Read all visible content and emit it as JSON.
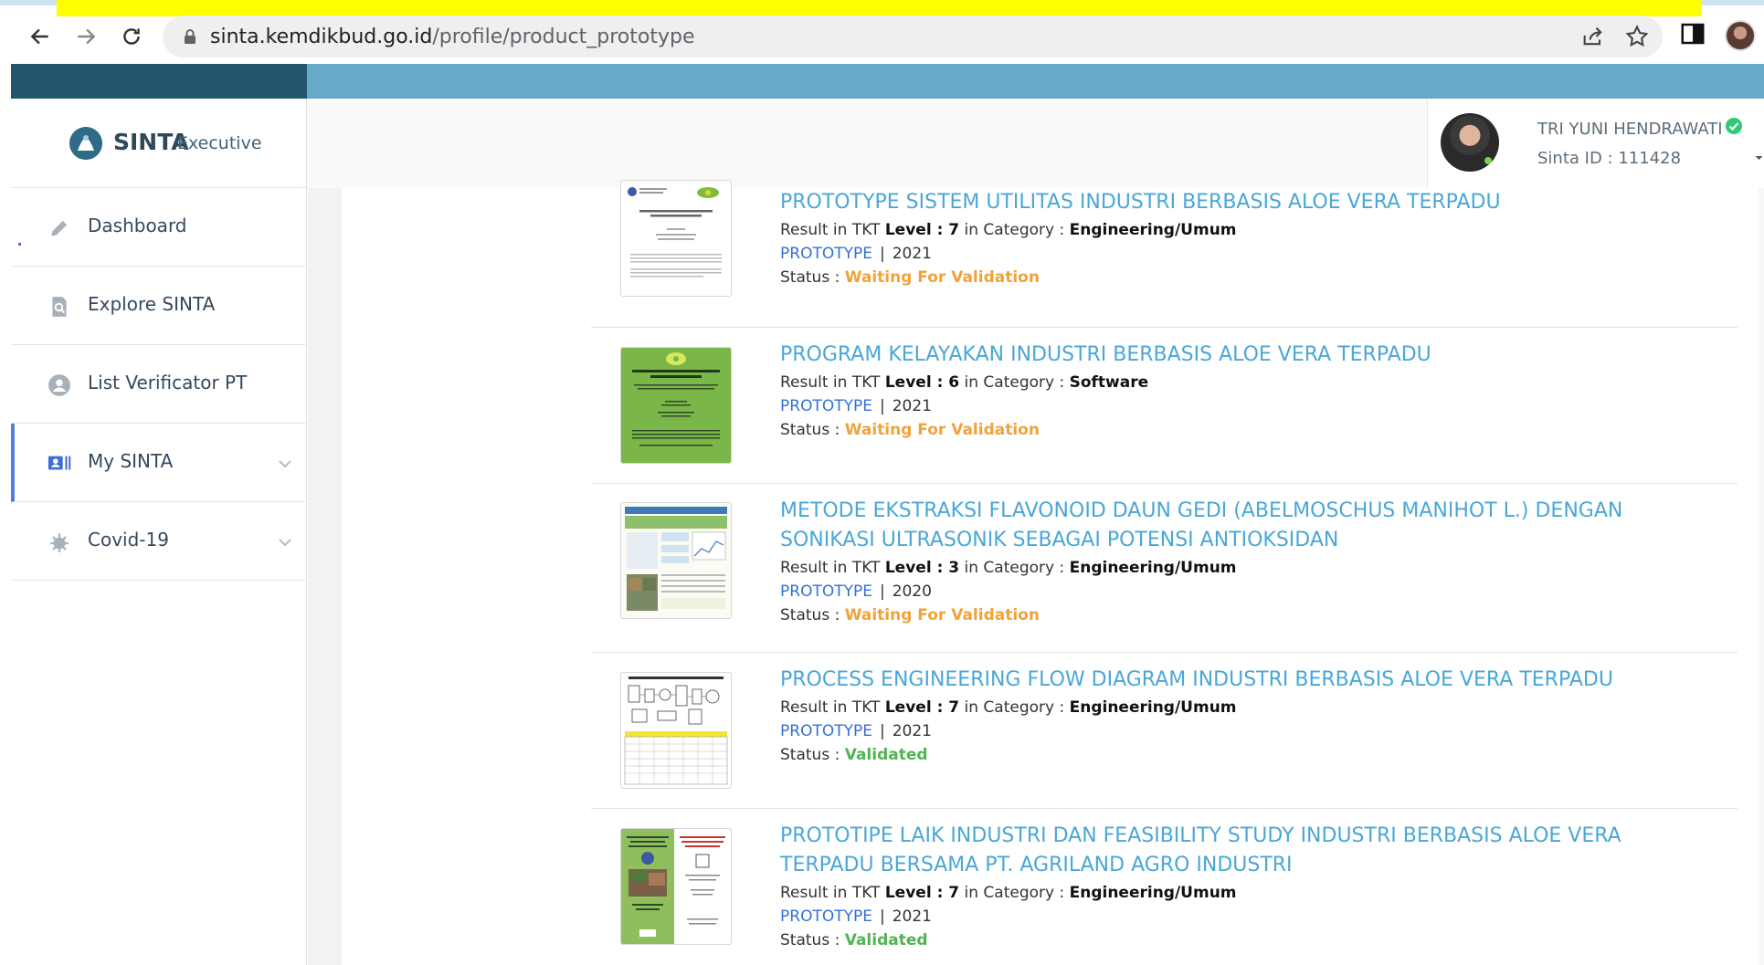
{
  "browser": {
    "url_domain": "sinta.kemdikbud.go.id",
    "url_path": "/profile/product_prototype"
  },
  "brand": {
    "name": "SINTA",
    "subtitle": "Executive"
  },
  "sidebar": {
    "items": [
      {
        "label": "Dashboard",
        "icon": "pencil-icon"
      },
      {
        "label": "Explore SINTA",
        "icon": "search-doc-icon"
      },
      {
        "label": "List Verificator PT",
        "icon": "user-circle-icon"
      },
      {
        "label": "My SINTA",
        "icon": "id-card-icon",
        "active": true
      },
      {
        "label": "Covid-19",
        "icon": "virus-icon"
      }
    ]
  },
  "user": {
    "name": "TRI YUNI HENDRAWATI",
    "sinta_id": "Sinta ID : 111428"
  },
  "items": [
    {
      "title": "PROTOTYPE SISTEM UTILITAS INDUSTRI BERBASIS ALOE VERA TERPADU",
      "result_prefix": "Result in TKT",
      "level_label": "Level : 7",
      "category_prefix": "in Category :",
      "category": "Engineering/Umum",
      "type": "PROTOTYPE",
      "year": "2021",
      "status_label": "Status :",
      "status": "Waiting For Validation",
      "status_kind": "waiting"
    },
    {
      "title": "PROGRAM KELAYAKAN INDUSTRI BERBASIS ALOE VERA TERPADU",
      "result_prefix": "Result in TKT",
      "level_label": "Level : 6",
      "category_prefix": "in Category :",
      "category": "Software",
      "type": "PROTOTYPE",
      "year": "2021",
      "status_label": "Status :",
      "status": "Waiting For Validation",
      "status_kind": "waiting"
    },
    {
      "title": "METODE EKSTRAKSI FLAVONOID DAUN GEDI (ABELMOSCHUS MANIHOT L.) DENGAN SONIKASI ULTRASONIK SEBAGAI POTENSI ANTIOKSIDAN",
      "result_prefix": "Result in TKT",
      "level_label": "Level : 3",
      "category_prefix": "in Category :",
      "category": "Engineering/Umum",
      "type": "PROTOTYPE",
      "year": "2020",
      "status_label": "Status :",
      "status": "Waiting For Validation",
      "status_kind": "waiting"
    },
    {
      "title": "PROCESS ENGINEERING FLOW DIAGRAM INDUSTRI BERBASIS ALOE VERA TERPADU",
      "result_prefix": "Result in TKT",
      "level_label": "Level : 7",
      "category_prefix": "in Category :",
      "category": "Engineering/Umum",
      "type": "PROTOTYPE",
      "year": "2021",
      "status_label": "Status :",
      "status": "Validated",
      "status_kind": "validated"
    },
    {
      "title": "PROTOTIPE LAIK INDUSTRI DAN FEASIBILITY STUDY INDUSTRI BERBASIS ALOE VERA TERPADU BERSAMA PT. AGRILAND AGRO INDUSTRI",
      "result_prefix": "Result in TKT",
      "level_label": "Level : 7",
      "category_prefix": "in Category :",
      "category": "Engineering/Umum",
      "type": "PROTOTYPE",
      "year": "2021",
      "status_label": "Status :",
      "status": "Validated",
      "status_kind": "validated"
    }
  ],
  "colors": {
    "band_dark": "#22566f",
    "band_light": "#66a9c8",
    "title_link": "#4aa7d6",
    "prototype_link": "#3470d8",
    "status_waiting": "#f0a33a",
    "status_validated": "#4fb452",
    "active_accent": "#4f7fd9"
  }
}
